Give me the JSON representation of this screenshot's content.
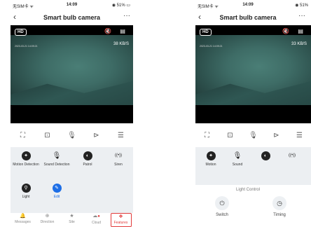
{
  "screens": [
    {
      "status": {
        "carrier": "无SIM卡 ᯤ",
        "time": "14:09",
        "battery": "◉ 51% ▭"
      },
      "nav": {
        "back": "‹",
        "title": "Smart bulb camera",
        "more": "···"
      },
      "video": {
        "hd": "HD",
        "icons": "🔇 ▤",
        "timestamp": "2023-03-21 14:09:21",
        "speed": "38 KB/S"
      },
      "toolbar": [
        "⛶",
        "⊡",
        "🎙",
        "⊳",
        "☰"
      ],
      "features": [
        {
          "label": "Motion Detection",
          "icon": "motion-icon"
        },
        {
          "label": "Sound Detection",
          "icon": "microphone-icon"
        },
        {
          "label": "Patrol",
          "icon": "patrol-icon"
        },
        {
          "label": "Siren",
          "icon": "siren-icon"
        },
        {
          "label": "Light",
          "icon": "lightbulb-icon"
        },
        {
          "label": "Edit",
          "icon": "pencil-icon"
        }
      ],
      "tabs": [
        {
          "label": "Messages",
          "icon": "bell-icon"
        },
        {
          "label": "Direction",
          "icon": "direction-icon"
        },
        {
          "label": "Site",
          "icon": "star-icon"
        },
        {
          "label": "Cloud",
          "icon": "cloud-icon"
        },
        {
          "label": "Features",
          "icon": "features-icon",
          "active": true
        }
      ]
    },
    {
      "status": {
        "carrier": "无SIM卡 ᯤ",
        "time": "14:09",
        "battery": "◉ 51%"
      },
      "nav": {
        "back": "‹",
        "title": "Smart bulb camera",
        "more": "···"
      },
      "video": {
        "hd": "HD",
        "icons": "🔇 ▤",
        "timestamp": "2023-03-21 14:09:21",
        "speed": "33 KB/S"
      },
      "toolbar": [
        "⛶",
        "⊡",
        "🎙",
        "⊳",
        "☰"
      ],
      "features": [
        {
          "label": "Motion",
          "icon": "motion-icon"
        },
        {
          "label": "Sound",
          "icon": "microphone-icon"
        },
        {
          "label": "",
          "icon": "patrol-icon"
        },
        {
          "label": "",
          "icon": "siren-icon"
        }
      ],
      "sheet": {
        "title": "Light Control",
        "items": [
          {
            "label": "Switch",
            "icon": "power-icon"
          },
          {
            "label": "Timing",
            "icon": "clock-icon"
          }
        ]
      }
    }
  ],
  "colors": {
    "accent": "#1d6ee6",
    "active_tab": "#e23b3b",
    "panel": "#eceff2"
  }
}
